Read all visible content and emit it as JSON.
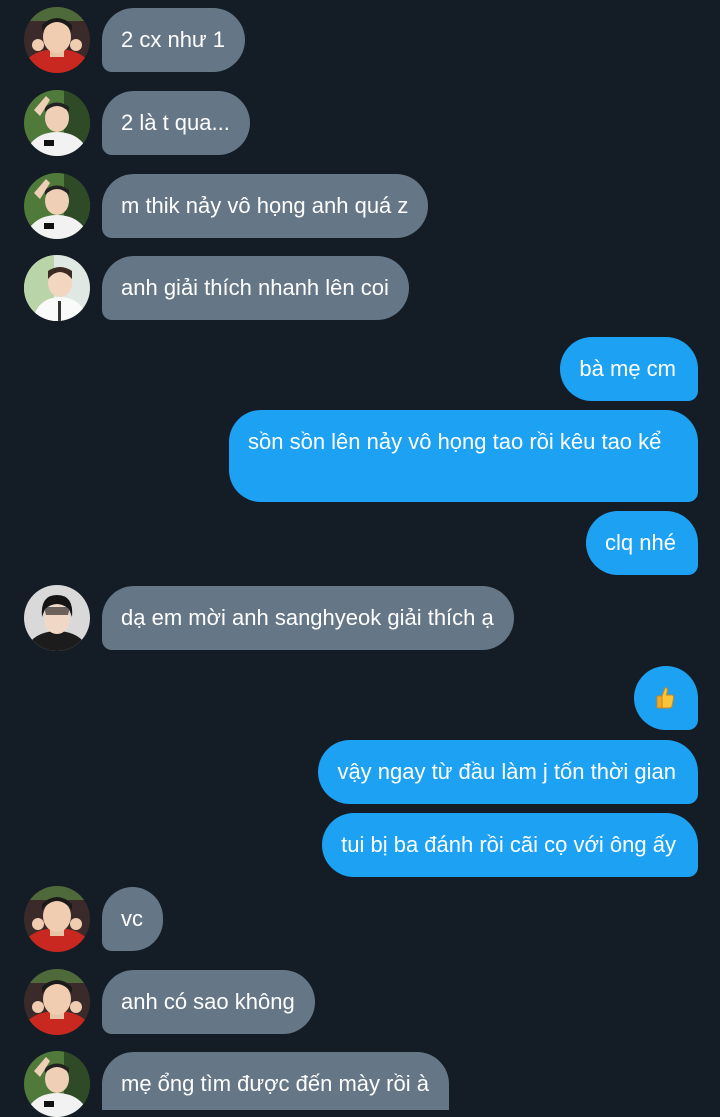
{
  "messages": [
    {
      "sender": "other",
      "avatar": "avatar-red-jacket",
      "text": "2 cx như 1"
    },
    {
      "sender": "other",
      "avatar": "avatar-kt-jersey",
      "text": "2 là t qua..."
    },
    {
      "sender": "other",
      "avatar": "avatar-kt-jersey",
      "text": "m thik nảy vô họng anh quá z"
    },
    {
      "sender": "other",
      "avatar": "avatar-white-shirt",
      "text": "anh giải thích nhanh lên coi"
    },
    {
      "sender": "me",
      "text": "bà mẹ cm"
    },
    {
      "sender": "me",
      "text": "sồn sồn lên nảy vô họng tao rồi kêu tao kể"
    },
    {
      "sender": "me",
      "text": "clq nhé"
    },
    {
      "sender": "other",
      "avatar": "avatar-dark-hair",
      "text": "dạ em mời anh sanghyeok giải thích ạ"
    },
    {
      "sender": "me",
      "emoji": "thumbs-up-icon"
    },
    {
      "sender": "me",
      "text": "vậy ngay từ đầu làm j tốn thời gian"
    },
    {
      "sender": "me",
      "text": "tui bị ba đánh rồi cãi cọ với ông ấy"
    },
    {
      "sender": "other",
      "avatar": "avatar-red-jacket",
      "text": "vc"
    },
    {
      "sender": "other",
      "avatar": "avatar-red-jacket",
      "text": "anh có sao không"
    },
    {
      "sender": "other",
      "avatar": "avatar-kt-jersey",
      "text": "mẹ ổng tìm được đến mày rồi à"
    }
  ],
  "colors": {
    "background": "#141d26",
    "incoming_bubble": "#657786",
    "outgoing_bubble": "#1da1f2",
    "text": "#ffffff"
  }
}
